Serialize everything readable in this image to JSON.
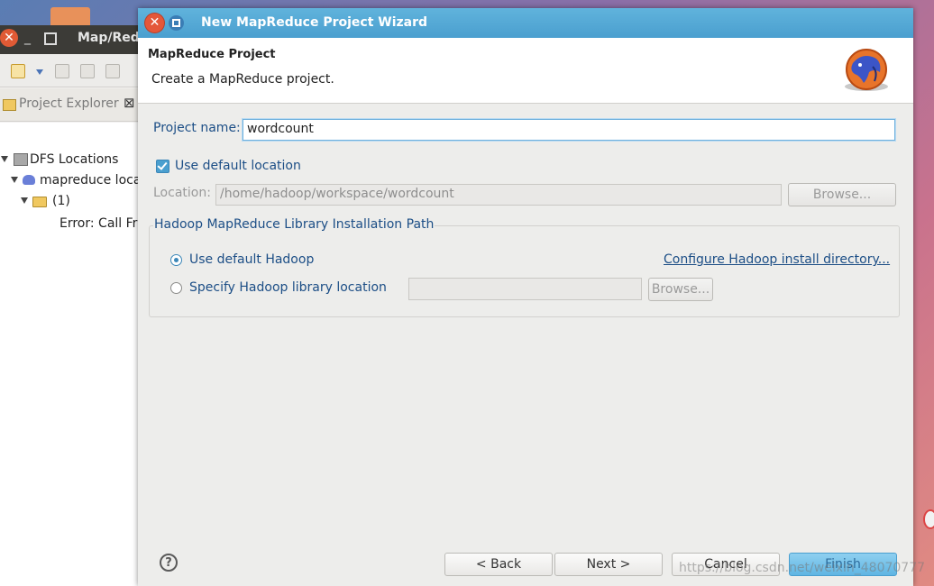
{
  "eclipse": {
    "window_title": "Map/Redu",
    "close_glyph": "✕",
    "minimize_glyph": "_",
    "tab_label": "Project Explorer",
    "tab_close": "⊠",
    "tree": {
      "dfs_locations": "DFS Locations",
      "mapreduce_location": "mapreduce loca",
      "folder_count": "(1)",
      "error": "Error: Call Fr"
    }
  },
  "dialog": {
    "title": "New MapReduce Project Wizard",
    "close_glyph": "✕",
    "banner_title": "MapReduce Project",
    "banner_message": "Create a MapReduce project.",
    "project_name_label": "Project name:",
    "project_name_value": "wordcount",
    "use_default_location_label": "Use default location",
    "use_default_location_checked": true,
    "location_label": "Location:",
    "location_value": "/home/hadoop/workspace/wordcount",
    "browse_label": "Browse...",
    "group_title": "Hadoop MapReduce Library Installation Path",
    "use_default_hadoop_label": "Use default Hadoop",
    "configure_link": "Configure Hadoop install directory...",
    "specify_hadoop_label": "Specify Hadoop library location",
    "specify_hadoop_value": "",
    "browse2_label": "Browse...",
    "selected_option": "use_default_hadoop",
    "help_glyph": "?",
    "back_label": "< Back",
    "next_label": "Next >",
    "cancel_label": "Cancel",
    "finish_label": "Finish"
  },
  "watermark": "https://blog.csdn.net/weixin_48070777",
  "colors": {
    "title_bar": "#4a9fcf",
    "label_text": "#1c4e86",
    "close_button": "#e4573a"
  },
  "icons": [
    "close-icon",
    "maximize-icon",
    "new-project-icon",
    "save-icon",
    "project-explorer-icon",
    "dfs-icon",
    "elephant-icon",
    "folder-icon",
    "hadoop-logo",
    "help-icon"
  ]
}
